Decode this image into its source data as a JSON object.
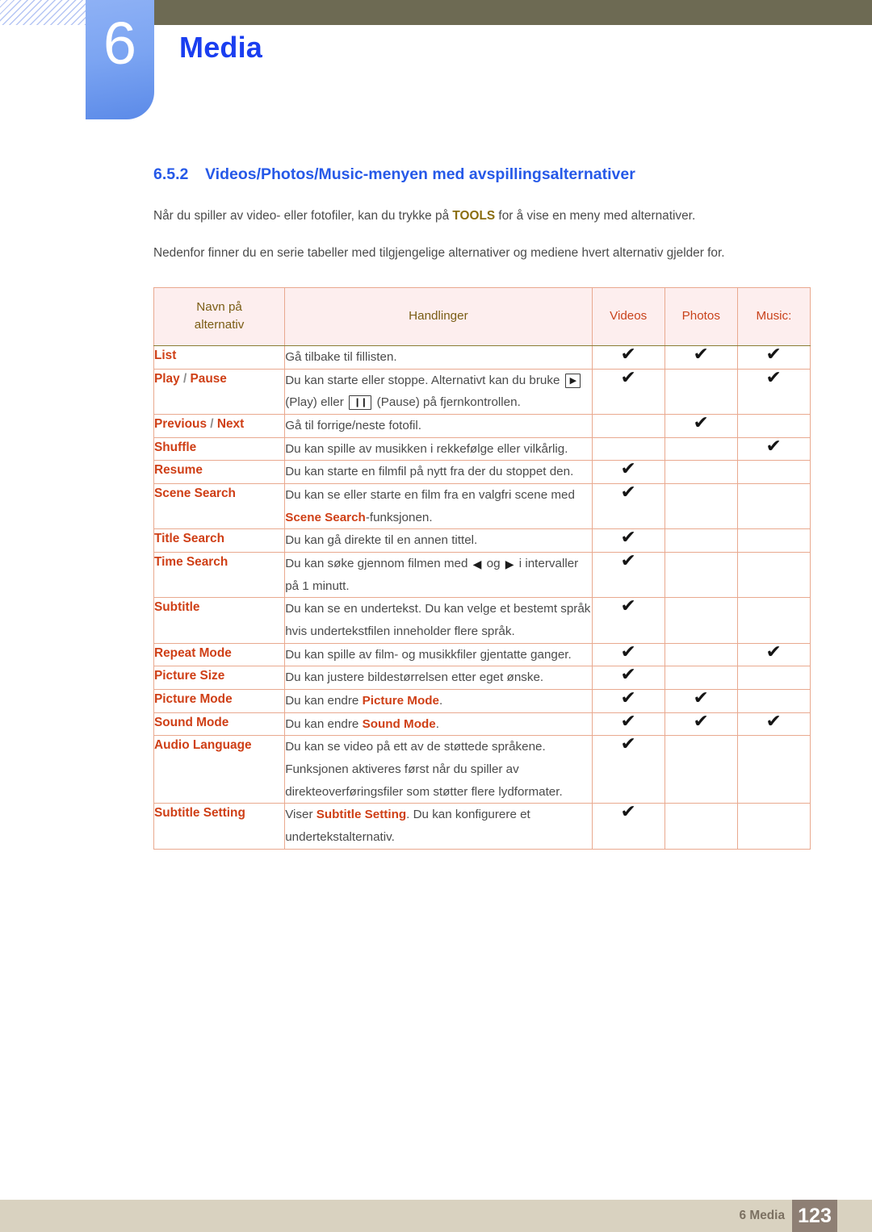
{
  "header": {
    "chapter_number": "6",
    "chapter_title": "Media",
    "accent_blue": "#1a3ef0",
    "badge_blue": "#7ba4f2",
    "olive_bar": "#6d6a53"
  },
  "section": {
    "number": "6.5.2",
    "title": "Videos/Photos/Music-menyen med avspillingsalternativer",
    "heading_color": "#2659e8",
    "paragraph_1_pre": "Når du spiller av video- eller fotofiler, kan du trykke på ",
    "paragraph_1_key": "TOOLS",
    "paragraph_1_post": " for å vise en meny med alternativer.",
    "paragraph_2": "Nedenfor finner du en serie tabeller med tilgjengelige alternativer og mediene hvert alternativ gjelder for."
  },
  "table": {
    "header_bg": "#fdeeee",
    "header_text_color": "#7a5c14",
    "media_head_color": "#c9431c",
    "option_name_color": "#cf3f16",
    "border_outer": "#8a7c33",
    "border_inner": "#e9a98f",
    "columns": {
      "name_line1": "Navn på",
      "name_line2": "alternativ",
      "actions": "Handlinger",
      "videos": "Videos",
      "photos": "Photos",
      "music": "Music:"
    },
    "check_glyph": "✔",
    "rows": [
      {
        "name_parts": [
          {
            "t": "List",
            "b": true
          }
        ],
        "action_parts": [
          {
            "t": "Gå tilbake til fillisten.",
            "b": false
          }
        ],
        "videos": true,
        "photos": true,
        "music": true
      },
      {
        "name_parts": [
          {
            "t": "Play",
            "b": true
          },
          {
            "t": " / ",
            "b": false,
            "sep": true
          },
          {
            "t": "Pause",
            "b": true
          }
        ],
        "action_parts": [
          {
            "t": "Du kan starte eller stoppe. Alternativt kan du bruke ",
            "b": false
          },
          {
            "t": "▶",
            "key": true
          },
          {
            "t": " (Play) eller ",
            "b": false
          },
          {
            "t": "❙❙",
            "key": true
          },
          {
            "t": " (Pause) på fjernkontrollen.",
            "b": false
          }
        ],
        "videos": true,
        "photos": false,
        "music": true
      },
      {
        "name_parts": [
          {
            "t": "Previous",
            "b": true
          },
          {
            "t": " / ",
            "b": false,
            "sep": true
          },
          {
            "t": "Next",
            "b": true
          }
        ],
        "action_parts": [
          {
            "t": "Gå til forrige/neste fotofil.",
            "b": false
          }
        ],
        "videos": false,
        "photos": true,
        "music": false
      },
      {
        "name_parts": [
          {
            "t": "Shuffle",
            "b": true
          }
        ],
        "action_parts": [
          {
            "t": "Du kan spille av musikken i rekkefølge eller vilkårlig.",
            "b": false
          }
        ],
        "videos": false,
        "photos": false,
        "music": true
      },
      {
        "name_parts": [
          {
            "t": "Resume",
            "b": true
          }
        ],
        "action_parts": [
          {
            "t": "Du kan starte en filmfil på nytt fra der du stoppet den.",
            "b": false
          }
        ],
        "videos": true,
        "photos": false,
        "music": false
      },
      {
        "name_parts": [
          {
            "t": "Scene Search",
            "b": true
          }
        ],
        "action_parts": [
          {
            "t": "Du kan se eller starte en film fra en valgfri scene med ",
            "b": false
          },
          {
            "t": "Scene Search",
            "b": true
          },
          {
            "t": "-funksjonen.",
            "b": false
          }
        ],
        "videos": true,
        "photos": false,
        "music": false
      },
      {
        "name_parts": [
          {
            "t": "Title Search",
            "b": true
          }
        ],
        "action_parts": [
          {
            "t": "Du kan gå direkte til en annen tittel.",
            "b": false
          }
        ],
        "videos": true,
        "photos": false,
        "music": false
      },
      {
        "name_parts": [
          {
            "t": "Time Search",
            "b": true
          }
        ],
        "action_parts": [
          {
            "t": "Du kan søke gjennom filmen med ",
            "b": false
          },
          {
            "t": "◀",
            "tri": true
          },
          {
            "t": " og ",
            "b": false
          },
          {
            "t": "▶",
            "tri": true
          },
          {
            "t": " i intervaller på 1 minutt.",
            "b": false
          }
        ],
        "videos": true,
        "photos": false,
        "music": false
      },
      {
        "name_parts": [
          {
            "t": "Subtitle",
            "b": true
          }
        ],
        "action_parts": [
          {
            "t": "Du kan se en undertekst. Du kan velge et bestemt språk hvis undertekstfilen inneholder flere språk.",
            "b": false
          }
        ],
        "videos": true,
        "photos": false,
        "music": false
      },
      {
        "name_parts": [
          {
            "t": "Repeat Mode",
            "b": true
          }
        ],
        "action_parts": [
          {
            "t": "Du kan spille av film- og musikkfiler gjentatte ganger.",
            "b": false
          }
        ],
        "videos": true,
        "photos": false,
        "music": true
      },
      {
        "name_parts": [
          {
            "t": "Picture Size",
            "b": true
          }
        ],
        "action_parts": [
          {
            "t": "Du kan justere bildestørrelsen etter eget ønske.",
            "b": false
          }
        ],
        "videos": true,
        "photos": false,
        "music": false
      },
      {
        "name_parts": [
          {
            "t": "Picture Mode",
            "b": true
          }
        ],
        "action_parts": [
          {
            "t": "Du kan endre ",
            "b": false
          },
          {
            "t": "Picture Mode",
            "b": true
          },
          {
            "t": ".",
            "b": false
          }
        ],
        "videos": true,
        "photos": true,
        "music": false
      },
      {
        "name_parts": [
          {
            "t": "Sound Mode",
            "b": true
          }
        ],
        "action_parts": [
          {
            "t": "Du kan endre ",
            "b": false
          },
          {
            "t": "Sound Mode",
            "b": true
          },
          {
            "t": ".",
            "b": false
          }
        ],
        "videos": true,
        "photos": true,
        "music": true
      },
      {
        "name_parts": [
          {
            "t": "Audio Language",
            "b": true
          }
        ],
        "action_parts": [
          {
            "t": "Du kan se video på ett av de støttede språkene. Funksjonen aktiveres først når du spiller av direkteoverføringsfiler som støtter flere lydformater.",
            "b": false
          }
        ],
        "videos": true,
        "photos": false,
        "music": false
      },
      {
        "name_parts": [
          {
            "t": "Subtitle Setting",
            "b": true
          }
        ],
        "action_parts": [
          {
            "t": "Viser ",
            "b": false
          },
          {
            "t": "Subtitle Setting",
            "b": true
          },
          {
            "t": ". Du kan konfigurere et undertekstalternativ.",
            "b": false
          }
        ],
        "videos": true,
        "photos": false,
        "music": false
      }
    ]
  },
  "footer": {
    "label": "6 Media",
    "page_number": "123",
    "bar_color": "#d9d2c0",
    "page_box_color": "#8e7f74"
  }
}
